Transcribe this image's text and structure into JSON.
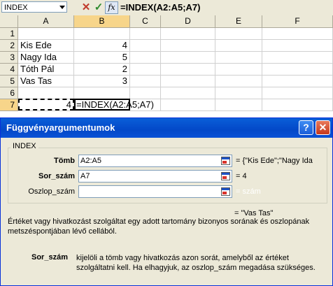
{
  "formula_bar": {
    "name_box": "INDEX",
    "cancel_icon": "x-cancel-icon",
    "enter_icon": "check-enter-icon",
    "function_icon": "fx",
    "formula": "=INDEX(A2:A5;A7)"
  },
  "sheet": {
    "columns": [
      "A",
      "B",
      "C",
      "D",
      "E",
      "F"
    ],
    "rows": [
      "1",
      "2",
      "3",
      "4",
      "5",
      "6",
      "7"
    ],
    "cells": {
      "A2": "Kis Ede",
      "B2": "4",
      "A3": "Nagy Ida",
      "B3": "5",
      "A4": "Tóth Pál",
      "B4": "2",
      "A5": "Vas Tas",
      "B5": "3",
      "A7": "4",
      "B7": "=INDEX(A2:A5;A7)"
    }
  },
  "dialog": {
    "title": "Függvényargumentumok",
    "help_label": "?",
    "close_label": "✕",
    "group_label": "INDEX",
    "args": [
      {
        "label": "Tömb",
        "value": "A2:A5",
        "result": "= {\"Kis Ede\";\"Nagy Ida"
      },
      {
        "label": "Sor_szám",
        "value": "A7",
        "result": "= 4"
      },
      {
        "label": "Oszlop_szám",
        "value": "",
        "result": "= szám"
      }
    ],
    "formula_result": "= \"Vas Tas\"",
    "description": "Értéket vagy hivatkozást szolgáltat egy adott tartomány bizonyos sorának és oszlopának metszéspontjában lévő cellából.",
    "param_name": "Sor_szám",
    "param_description": "kijelöli a tömb vagy hivatkozás azon sorát, amelyből az értéket szolgáltatni kell. Ha elhagyjuk, az oszlop_szám megadása szükséges."
  }
}
